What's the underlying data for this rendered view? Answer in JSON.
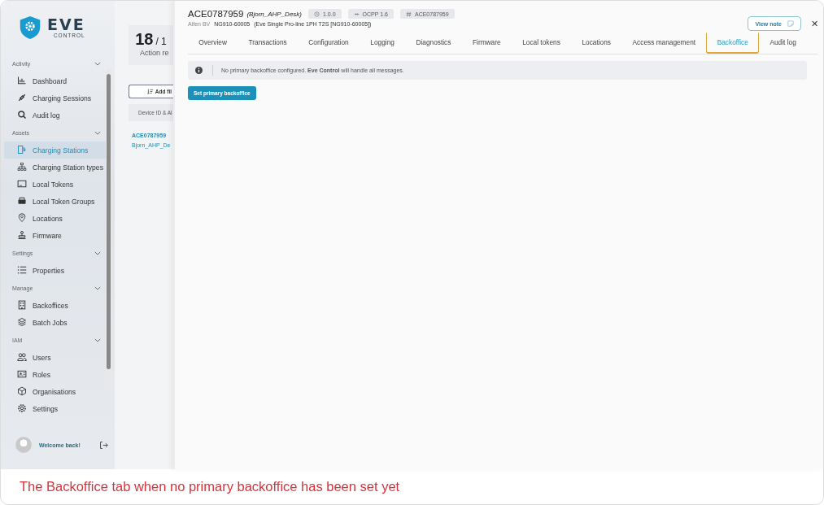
{
  "sidebar": {
    "logo": {
      "word": "EVE",
      "tagline": "CONTROL"
    },
    "sections": [
      {
        "label": "Activity",
        "expanded": true,
        "items": [
          {
            "label": "Dashboard",
            "selected": false
          },
          {
            "label": "Charging Sessions",
            "selected": false
          },
          {
            "label": "Audit log",
            "selected": false
          }
        ]
      },
      {
        "label": "Assets",
        "expanded": true,
        "items": [
          {
            "label": "Charging Stations",
            "selected": true
          },
          {
            "label": "Charging Station types",
            "selected": false
          },
          {
            "label": "Local Tokens",
            "selected": false
          },
          {
            "label": "Local Token Groups",
            "selected": false
          },
          {
            "label": "Locations",
            "selected": false
          },
          {
            "label": "Firmware",
            "selected": false
          }
        ]
      },
      {
        "label": "Settings",
        "expanded": true,
        "items": [
          {
            "label": "Properties",
            "selected": false
          }
        ]
      },
      {
        "label": "Manage",
        "expanded": true,
        "items": [
          {
            "label": "Backoffices",
            "selected": false
          },
          {
            "label": "Batch Jobs",
            "selected": false
          }
        ]
      },
      {
        "label": "IAM",
        "expanded": true,
        "items": [
          {
            "label": "Users",
            "selected": false
          },
          {
            "label": "Roles",
            "selected": false
          },
          {
            "label": "Organisations",
            "selected": false
          },
          {
            "label": "Settings",
            "selected": false
          }
        ]
      }
    ],
    "footer": {
      "greeting": "Welcome back!"
    }
  },
  "page": {
    "count": "18",
    "count_suffix": "/ 1",
    "count_label": "Action re",
    "filter_button": "Add fil",
    "column_1": "Device ID & Al",
    "rows": [
      {
        "id": "ACE0787959",
        "name": "Bjorn_AHP_De"
      }
    ]
  },
  "drawer": {
    "title": "ACE0787959",
    "alias": "(Bjorn_AHP_Desk)",
    "chips": [
      {
        "label": "1.0.0"
      },
      {
        "label": "OCPP 1.6"
      },
      {
        "label": "ACE0787959"
      }
    ],
    "vendor": "Alfen BV",
    "model": "NG910-60005",
    "model_detail": "(Eve Single Pro-line 1PH T2S [NG910-60005])",
    "view_note": "View note",
    "close": "✕",
    "tabs": [
      {
        "label": "Overview",
        "selected": false
      },
      {
        "label": "Transactions",
        "selected": false
      },
      {
        "label": "Configuration",
        "selected": false
      },
      {
        "label": "Logging",
        "selected": false
      },
      {
        "label": "Diagnostics",
        "selected": false
      },
      {
        "label": "Firmware",
        "selected": false
      },
      {
        "label": "Local tokens",
        "selected": false
      },
      {
        "label": "Locations",
        "selected": false
      },
      {
        "label": "Access management",
        "selected": false
      },
      {
        "label": "Backoffice",
        "selected": true
      },
      {
        "label": "Audit log",
        "selected": false
      }
    ],
    "alert": "No primary backoffice configured. **Eve Control** will handle all messages.",
    "action": "Set primary backoffice"
  },
  "caption": "The Backoffice tab when no primary backoffice has been set yet"
}
